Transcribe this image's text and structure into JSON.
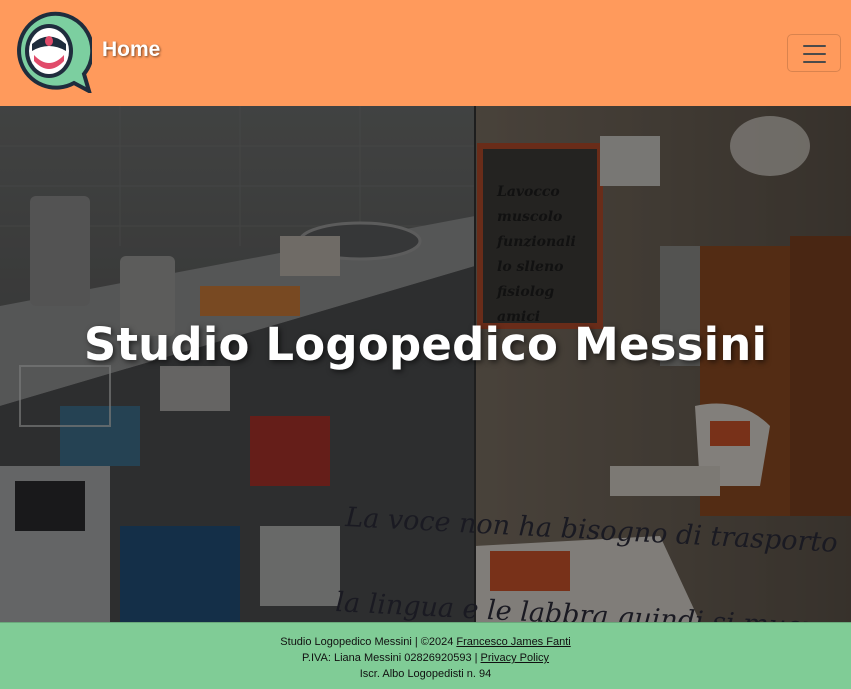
{
  "navbar": {
    "brand_label": "Home",
    "logo_icon": "speech-bubble-mouth-icon",
    "menu_icon": "hamburger-menu-icon",
    "colors": {
      "background": "#ff9a5c",
      "logo_ring": "#7ccfa0",
      "logo_outline": "#1f2d3d"
    }
  },
  "hero": {
    "title": "Studio Logopedico Messini",
    "wall_quote_line1": "La voce non ha bisogno di trasporto",
    "wall_quote_line2": "la lingua e le labbra quindi si muovo",
    "wall_poster_lines": [
      "Lavocco",
      "muscolo",
      "funzionali",
      "lo slleno",
      "fisiolog",
      "amici"
    ]
  },
  "footer": {
    "line1_text": "Studio Logopedico Messini | ©2024 ",
    "line1_link": "Francesco James Fanti",
    "line2_text": "P.IVA: Liana Messini 02826920593 | ",
    "line2_link": "Privacy Policy",
    "line3_text": "Iscr. Albo Logopedisti n. 94",
    "colors": {
      "background": "#80cc96"
    }
  }
}
